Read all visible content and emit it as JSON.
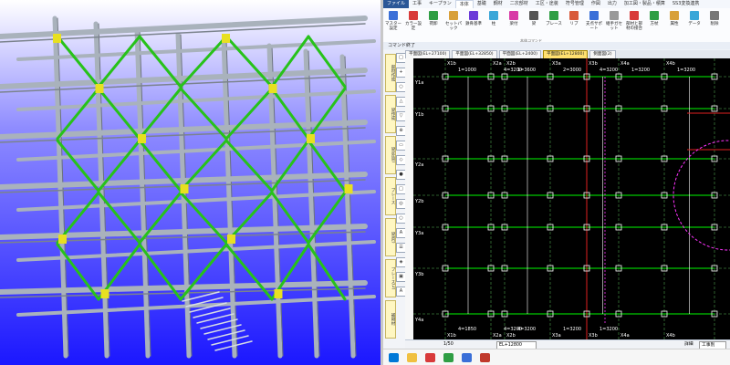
{
  "menubar": {
    "items": [
      "ファイル",
      "工事",
      "キープラン",
      "本体",
      "基礎",
      "鋼材",
      "二次部材",
      "工区・途装",
      "符号管理",
      "作図",
      "出力",
      "加工図・製品・積算",
      "SS3変換連携"
    ],
    "active_index": 3
  },
  "ribbon": {
    "buttons": [
      "マスター設定",
      "カラー設定",
      "荷卸",
      "セットパック",
      "鉄骨基準",
      "柱",
      "梁付",
      "梁",
      "ブレース",
      "リブ",
      "支点サポート",
      "継手ガセット",
      "部材と部材の接合",
      "方杖",
      "属性",
      "データ",
      "削除"
    ],
    "group_label": "本体コマンド"
  },
  "command_bar": {
    "label": "コマンド終了"
  },
  "left_toolbar": {
    "vertical_tabs": [
      "部材作成",
      "梁作成",
      "梁(外周)",
      "ブレース",
      "梁(内)",
      "ブレース(2)",
      "補剛材"
    ],
    "tool_icons": [
      "□",
      "+",
      "○",
      "△",
      "▽",
      "⊕",
      "▭",
      "◇",
      "●",
      "□",
      "◎",
      "○",
      "A",
      "☰",
      "◈",
      "▣",
      "A"
    ]
  },
  "view_tabs": [
    "平面図(EL+27100)",
    "平面図(EL+32850)",
    "平面図(EL+2400)",
    "平面図(EL+12800)",
    "側面図(2)"
  ],
  "view_tabs_selected": 3,
  "grid_labels": {
    "top": [
      "X1b",
      "X2a",
      "X2b",
      "X3a",
      "X3b",
      "X4a",
      "X4b"
    ],
    "bottom": [
      "X1b",
      "X2a",
      "X2b",
      "X3a",
      "X3b",
      "X4a",
      "X4b"
    ],
    "left": [
      "Y1a",
      "Y1b",
      "Y2a",
      "Y2b",
      "Y3a",
      "Y3b",
      "Y4a"
    ]
  },
  "dimensions": {
    "top": [
      "1=1000",
      "4=3200",
      "1=3600",
      "2=3000",
      "4=3200",
      "1=3200",
      "1=3200"
    ],
    "bottom": [
      "4=1850",
      "4=3200",
      "4=3200",
      "1=3200",
      "1=3200"
    ]
  },
  "status_bar": {
    "scale": "1/50",
    "elevation": "EL+12800",
    "mode_label": "詳細",
    "mode_value": "工事別"
  },
  "colors": {
    "steel_grey": "#a9b2bc",
    "brace_green": "#27c21a",
    "joint_yellow": "#e8e020",
    "sky_top": "#ffffff",
    "sky_bottom": "#1b17ff",
    "cad_bg": "#000000",
    "cad_green": "#00c800",
    "cad_red": "#e02020",
    "cad_magenta": "#ff33ff",
    "cad_white": "#ffffff",
    "ribbon_accent": "#2b5797"
  },
  "taskbar_icons": [
    "start-icon",
    "explorer-icon",
    "cad-icon",
    "mail-icon",
    "browser-icon",
    "pdf-icon"
  ]
}
